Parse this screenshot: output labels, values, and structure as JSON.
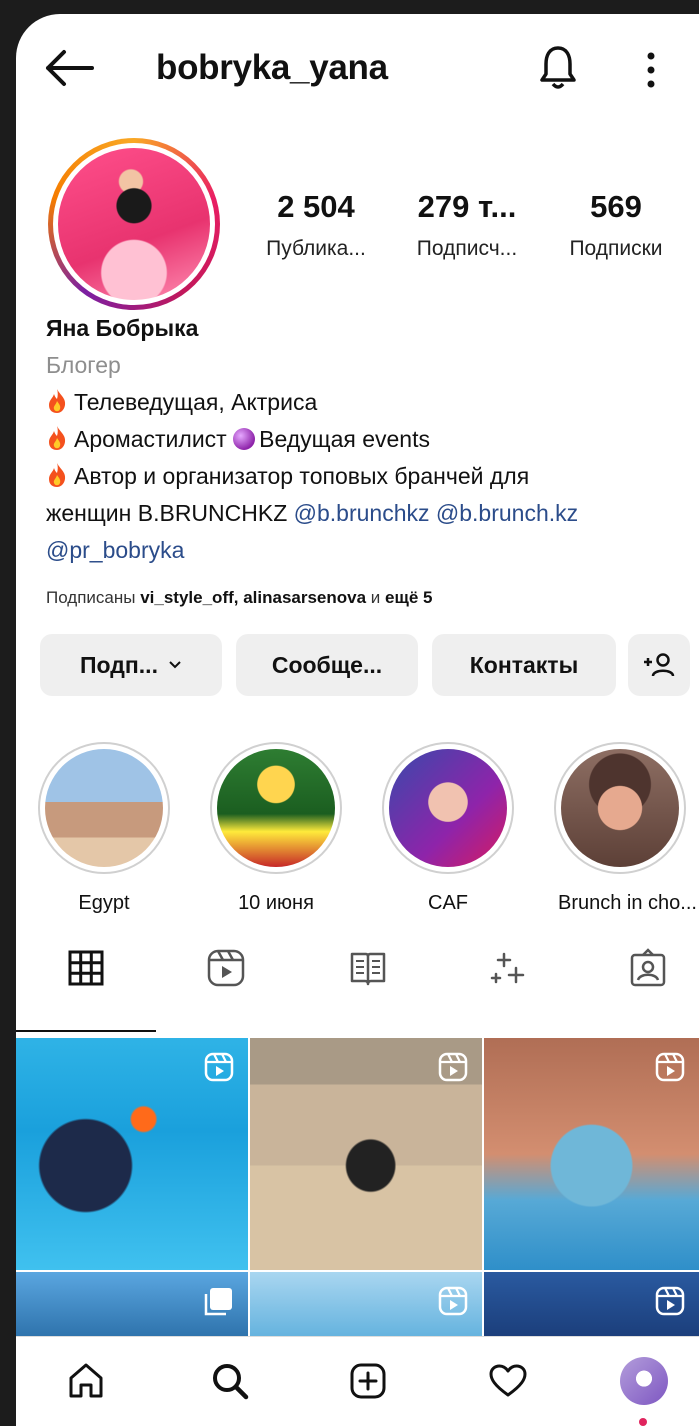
{
  "header": {
    "username": "bobryka_yana"
  },
  "stats": [
    {
      "value": "2 504",
      "label": "Публика..."
    },
    {
      "value": "279 т...",
      "label": "Подписч..."
    },
    {
      "value": "569",
      "label": "Подписки"
    }
  ],
  "bio": {
    "name": "Яна Бобрыка",
    "category": "Блогер",
    "line1": "Телеведущая, Актриса",
    "line2a": "Аромастилист",
    "line2b": "Ведущая events",
    "line3": "Автор и организатор топовых бранчей для",
    "line4_text": "женщин B.BRUNCHKZ",
    "mention1": "@b.brunchkz",
    "mention2": "@b.brunch.kz",
    "mention3": "@pr_bobryka"
  },
  "followed_by": {
    "prefix": "Подписаны",
    "names": "vi_style_off, alinasarsenova",
    "and": "и",
    "more": "ещё 5"
  },
  "buttons": {
    "follow": "Подп...",
    "message": "Сообще...",
    "contacts": "Контакты"
  },
  "highlights": [
    {
      "label": "Egypt"
    },
    {
      "label": "10 июня"
    },
    {
      "label": "CAF"
    },
    {
      "label": "Brunch in cho..."
    }
  ],
  "colors": {
    "link": "#2b4c8a",
    "accent_dot": "#e0245e",
    "button_bg": "#efefef"
  },
  "tabs": [
    "grid-icon",
    "reels-icon",
    "guides-icon",
    "effects-icon",
    "tagged-icon"
  ],
  "nav": [
    "home-icon",
    "search-icon",
    "create-icon",
    "activity-icon",
    "profile-avatar"
  ]
}
